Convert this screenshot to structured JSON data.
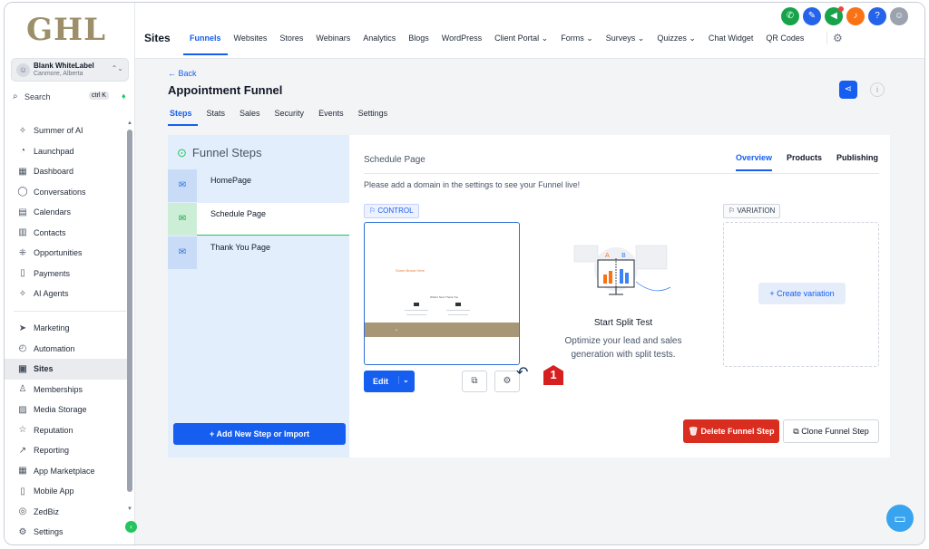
{
  "brand": {
    "logo": "GHL"
  },
  "account": {
    "name": "Blank WhiteLabel",
    "location": "Canmore, Alberta"
  },
  "search": {
    "label": "Search",
    "shortcut": "ctrl K"
  },
  "sidebar": {
    "items_top": [
      {
        "label": "Summer of AI",
        "icon": "✧"
      },
      {
        "label": "Launchpad",
        "icon": "◔"
      },
      {
        "label": "Dashboard",
        "icon": "▦"
      },
      {
        "label": "Conversations",
        "icon": "◯"
      },
      {
        "label": "Calendars",
        "icon": "▤"
      },
      {
        "label": "Contacts",
        "icon": "▥"
      },
      {
        "label": "Opportunities",
        "icon": "⁜"
      },
      {
        "label": "Payments",
        "icon": "▯"
      },
      {
        "label": "AI Agents",
        "icon": "✧"
      }
    ],
    "items_bottom": [
      {
        "label": "Marketing",
        "icon": "➤"
      },
      {
        "label": "Automation",
        "icon": "◴"
      },
      {
        "label": "Sites",
        "icon": "▣"
      },
      {
        "label": "Memberships",
        "icon": "♙"
      },
      {
        "label": "Media Storage",
        "icon": "▨"
      },
      {
        "label": "Reputation",
        "icon": "☆"
      },
      {
        "label": "Reporting",
        "icon": "↗"
      },
      {
        "label": "App Marketplace",
        "icon": "▦"
      },
      {
        "label": "Mobile App",
        "icon": "▯"
      },
      {
        "label": "ZedBiz",
        "icon": "◎"
      },
      {
        "label": "Settings",
        "icon": "⚙"
      }
    ],
    "active": "Sites"
  },
  "topbar": {
    "section": "Sites",
    "tabs": [
      "Funnels",
      "Websites",
      "Stores",
      "Webinars",
      "Analytics",
      "Blogs",
      "WordPress",
      "Client Portal ⌄",
      "Forms ⌄",
      "Surveys ⌄",
      "Quizzes ⌄",
      "Chat Widget",
      "QR Codes"
    ],
    "active_tab": "Funnels",
    "icons": [
      {
        "name": "phone",
        "glyph": "✆",
        "color": "#16a34a"
      },
      {
        "name": "magic",
        "glyph": "✎",
        "color": "#2563eb"
      },
      {
        "name": "megaphone",
        "glyph": "◀",
        "color": "#16a34a"
      },
      {
        "name": "bell",
        "glyph": "♪",
        "color": "#f97316"
      },
      {
        "name": "help",
        "glyph": "?",
        "color": "#2563eb"
      },
      {
        "name": "avatar",
        "glyph": "☺",
        "color": "#9ca3af"
      }
    ]
  },
  "funnel": {
    "back_label": "← Back",
    "title": "Appointment Funnel",
    "tabs": [
      "Steps",
      "Stats",
      "Sales",
      "Security",
      "Events",
      "Settings"
    ],
    "active_tab": "Steps"
  },
  "steps_panel": {
    "header": "Funnel Steps",
    "steps": [
      "HomePage",
      "Schedule Page",
      "Thank You Page"
    ],
    "active_step": "Schedule Page",
    "add_button": "+    Add New Step or Import"
  },
  "main": {
    "page_title": "Schedule Page",
    "tabs": [
      "Overview",
      "Products",
      "Publishing"
    ],
    "active_tab": "Overview",
    "domain_message": "Please add a domain in the settings to see your Funnel live!",
    "control_label": "CONTROL",
    "variation_label": "VARIATION",
    "edit_label": "Edit",
    "split_title": "Start Split Test",
    "split_desc": "Optimize your lead and sales generation with split tests.",
    "create_variation": "+   Create variation",
    "delete_button": "Delete Funnel Step",
    "clone_button": "Clone Funnel Step",
    "annotation_number": "1",
    "preview_brand": "Some Brand Here",
    "preview_heading": "What's Next Thank You"
  },
  "colors": {
    "accent": "#155eef",
    "danger": "#d92d20",
    "success": "#22c55e",
    "brand": "#9c8f6a"
  }
}
